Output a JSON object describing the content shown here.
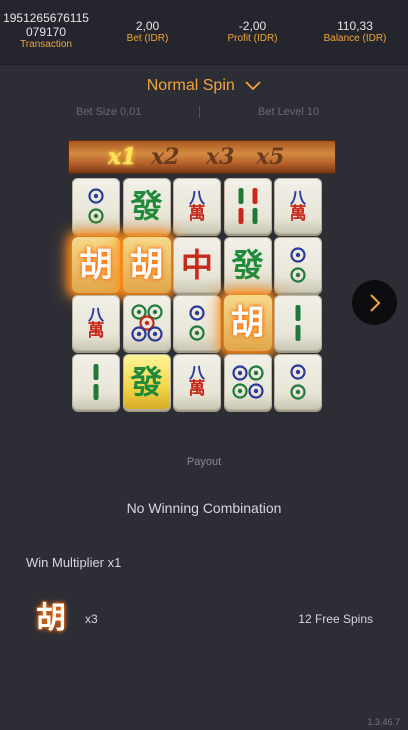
{
  "stats": {
    "transaction_value": "1951265676115\n079170",
    "transaction_label": "Transaction",
    "bet_value": "2,00",
    "bet_label": "Bet (IDR)",
    "profit_value": "-2,00",
    "profit_label": "Profit (IDR)",
    "balance_value": "110,33",
    "balance_label": "Balance (IDR)"
  },
  "spin": {
    "mode": "Normal Spin",
    "bet_size": "Bet Size 0,01",
    "bet_level": "Bet Level 10"
  },
  "multipliers": [
    "x1",
    "x2",
    "x3",
    "x5"
  ],
  "active_multiplier": "x1",
  "grid": [
    [
      "circles-2",
      "fa",
      "wan-8",
      "bamboo-4",
      "wan-8"
    ],
    [
      "hu",
      "hu",
      "zhong",
      "fa",
      "circles-2"
    ],
    [
      "wan-8",
      "circles-5",
      "circles-2",
      "hu",
      "bamboo-2"
    ],
    [
      "bamboo-2",
      "fa-gold",
      "wan-8",
      "circles-4",
      "circles-2"
    ]
  ],
  "tile_glyphs": {
    "fa": "發",
    "zhong": "中",
    "hu": "胡",
    "wan_top": "八",
    "wan_bottom": "萬"
  },
  "payout": {
    "label": "Payout",
    "result": "No Winning Combination",
    "win_multiplier": "Win Multiplier x1",
    "scatter_count": "x3",
    "free_spins": "12 Free Spins"
  },
  "version": "1.3.46.7",
  "colors": {
    "accent": "#f0a63a",
    "background": "#2d2d36"
  }
}
